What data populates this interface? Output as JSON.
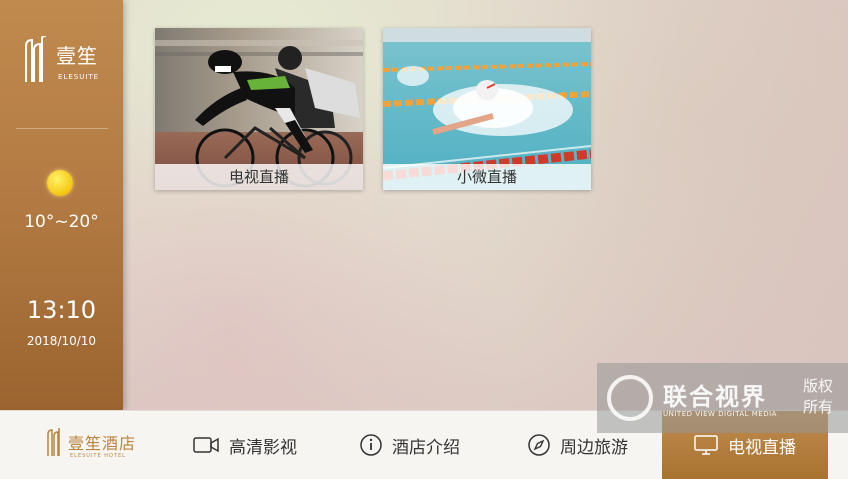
{
  "sidebar": {
    "logo_cn": "壹笙",
    "logo_en": "ELESUITE",
    "weather_icon": "sun-icon",
    "temperature": "10°~20°",
    "time": "13:10",
    "date": "2018/10/10"
  },
  "tiles": [
    {
      "label": "电视直播",
      "image": "cycling-photo"
    },
    {
      "label": "小微直播",
      "image": "swimming-photo"
    }
  ],
  "bottombar": {
    "logo_cn": "壹笙酒店",
    "logo_en": "ELESUITE HOTEL",
    "items": [
      {
        "label": "高清影视",
        "icon": "video-camera-icon"
      },
      {
        "label": "酒店介绍",
        "icon": "info-icon"
      },
      {
        "label": "周边旅游",
        "icon": "compass-icon"
      },
      {
        "label": "电视直播",
        "icon": "tv-icon"
      }
    ],
    "active_index": 3
  },
  "watermark": {
    "cn": "联合视界",
    "en": "UNITED VIEW DIGITAL MEDIA",
    "side": "版权所有"
  },
  "colors": {
    "accent": "#b27a42",
    "active_tab": "#a8722f"
  }
}
